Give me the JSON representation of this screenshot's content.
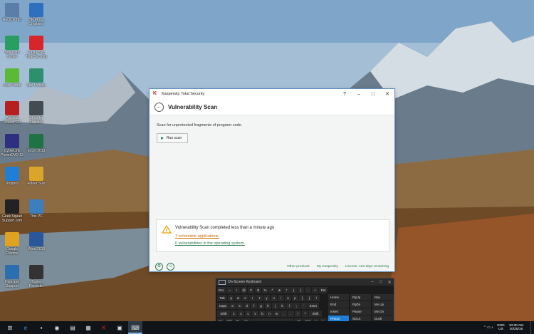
{
  "desktop_icons": [
    {
      "label": "Recycle Bin",
      "icon": "recycle-bin-icon",
      "color": "#5a7ea8"
    },
    {
      "label": "HP Photo Creations",
      "icon": "photo-app-icon",
      "color": "#2f6fbf"
    },
    {
      "label": "SafeCare Center",
      "icon": "safecare-icon",
      "color": "#2a9d63"
    },
    {
      "label": "Kaspersky Total Security",
      "icon": "kaspersky-icon",
      "color": "#d7262b"
    },
    {
      "label": "Acer Portal",
      "icon": "acer-portal-icon",
      "color": "#5ab936"
    },
    {
      "label": "Site Monitor",
      "icon": "site-monitor-icon",
      "color": "#2c8f6d"
    },
    {
      "label": "Acrobat Reader DC",
      "icon": "acrobat-icon",
      "color": "#b51f1f"
    },
    {
      "label": "Shop for Supplies",
      "icon": "shop-supplies-icon",
      "color": "#444b52"
    },
    {
      "label": "CyberLink PowerDVD 12",
      "icon": "powerdvd-icon",
      "color": "#2f2f80"
    },
    {
      "label": "Excel 2013",
      "icon": "excel-icon",
      "color": "#1f7244"
    },
    {
      "label": "Dropbox",
      "icon": "dropbox-icon",
      "color": "#1f7fd6"
    },
    {
      "label": "Folder Size",
      "icon": "folder-size-icon",
      "color": "#d9a52b"
    },
    {
      "label": "Geek Squad Support.com",
      "icon": "geek-squad-icon",
      "color": "#222222"
    },
    {
      "label": "This PC",
      "icon": "this-pc-icon",
      "color": "#3d7ebf"
    },
    {
      "label": "Google Chrome",
      "icon": "chrome-icon",
      "color": "#e0a320"
    },
    {
      "label": "Word 2013",
      "icon": "word-icon",
      "color": "#2b579a"
    },
    {
      "label": "Help and Support",
      "icon": "help-support-icon",
      "color": "#2b6fb1"
    },
    {
      "label": "Tablet Recorder",
      "icon": "tablet-recorder-icon",
      "color": "#333333"
    }
  ],
  "kaspersky": {
    "app_title": "Kaspersky Total Security",
    "help_glyph": "?",
    "minimize_glyph": "–",
    "restore_glyph": "□",
    "close_glyph": "✕",
    "back_glyph": "←",
    "page_title": "Vulnerability Scan",
    "description": "Scan for unprotected fragments of program code.",
    "run_scan_label": "Run scan",
    "notice_title": "Vulnerability Scan completed less than a minute ago",
    "vulnerable_apps_link": "7 vulnerable applications.",
    "os_vulns_link": "0 vulnerabilities in the operating system.",
    "footer_links": [
      "Other products",
      "My Kaspersky",
      "License: 193 days remaining"
    ],
    "accent_color": "#2a7b4f",
    "warning_color": "#e8a200",
    "link_orange": "#c96a00"
  },
  "osk": {
    "title": "On-Screen Keyboard",
    "rows": [
      [
        "Esc",
        "~",
        "!",
        "@",
        "#",
        "$",
        "%",
        "^",
        "&",
        "*",
        "(",
        ")",
        "-",
        "+",
        "Del"
      ],
      [
        "Tab",
        "q",
        "w",
        "e",
        "r",
        "t",
        "y",
        "u",
        "i",
        "o",
        "p",
        "[",
        "]",
        "\\"
      ],
      [
        "Caps",
        "a",
        "s",
        "d",
        "f",
        "g",
        "h",
        "j",
        "k",
        "l",
        ";",
        "'",
        "Enter"
      ],
      [
        "Shift",
        "z",
        "x",
        "c",
        "v",
        "b",
        "n",
        "m",
        ",",
        ".",
        "/",
        "^",
        "Shift"
      ],
      [
        "Fn",
        "Ctrl",
        "⊞",
        "Alt",
        "",
        "Alt",
        "Ctrl",
        "<",
        "v",
        ">"
      ]
    ],
    "nav_keys": [
      [
        "Home",
        "PgUp",
        "Nav"
      ],
      [
        "End",
        "PgDn",
        "Mv Up"
      ],
      [
        "Insert",
        "Pause",
        "Mv Dn"
      ],
      [
        "PrtScn",
        "ScrLk",
        "Dock"
      ],
      [
        "Options",
        "Help",
        "Fade"
      ]
    ],
    "highlight_key": "PrtScn"
  },
  "taskbar": {
    "apps": [
      {
        "icon": "windows-start-icon",
        "glyph": "⊞"
      },
      {
        "icon": "edge-icon",
        "glyph": "e"
      },
      {
        "icon": "taskbar-app-icon",
        "glyph": "▪"
      },
      {
        "icon": "chrome-taskbar-icon",
        "glyph": "◉"
      },
      {
        "icon": "file-explorer-icon",
        "glyph": "▤"
      },
      {
        "icon": "calendar-icon",
        "glyph": "▦"
      },
      {
        "icon": "kaspersky-taskbar-icon",
        "glyph": "K"
      },
      {
        "icon": "network-app-icon",
        "glyph": "▣"
      },
      {
        "icon": "keyboard-taskbar-icon",
        "glyph": "⌨"
      }
    ],
    "lang_top": "ENG",
    "lang_bottom": "US",
    "time": "10:30 AM",
    "date": "10/25/16"
  }
}
